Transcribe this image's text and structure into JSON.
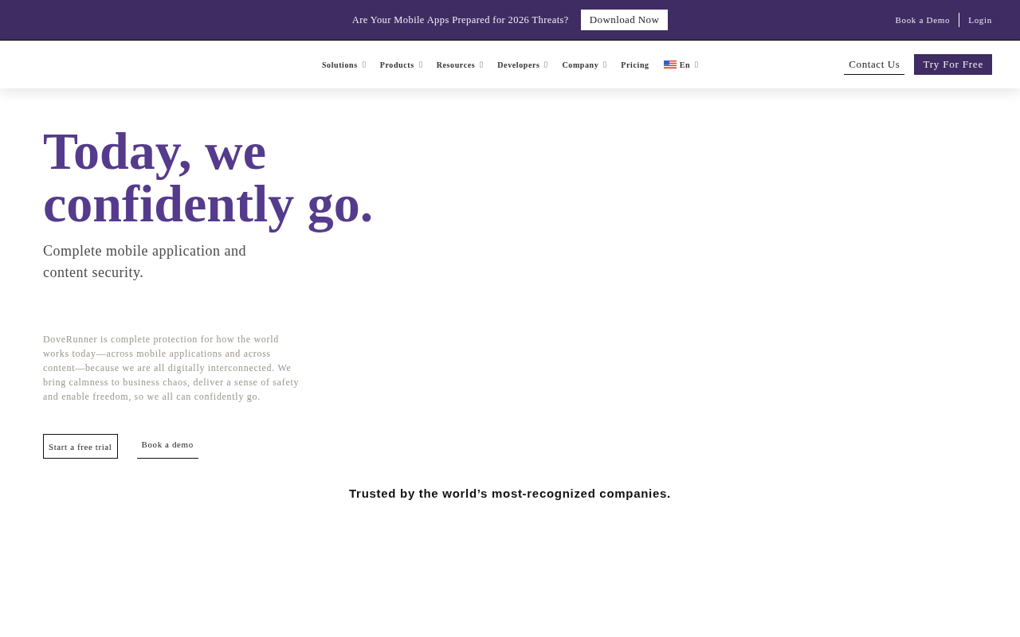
{
  "announcement_bar": {
    "message": "Are Your Mobile Apps Prepared for 2026 Threats?",
    "download_button": "Download Now",
    "links": [
      {
        "label": "Book a Demo"
      },
      {
        "label": "Login"
      }
    ]
  },
  "nav": {
    "items": [
      {
        "label": "Solutions",
        "kind": "link",
        "has_dropdown": true
      },
      {
        "label": "Products",
        "kind": "link",
        "has_dropdown": true
      },
      {
        "label": "Resources",
        "kind": "link",
        "has_dropdown": true
      },
      {
        "label": "Developers",
        "kind": "link",
        "has_dropdown": true
      },
      {
        "label": "Company",
        "kind": "link",
        "has_dropdown": true
      },
      {
        "label": "Pricing",
        "kind": "link",
        "has_dropdown": false
      },
      {
        "label": "En",
        "kind": "language",
        "has_dropdown": true
      }
    ],
    "contact_button": "Contact Us",
    "trial_button": "Try For Free"
  },
  "hero": {
    "title": "Today, we confidently go.",
    "subtitle": "Complete mobile application and content security.",
    "description": "DoveRunner is complete protection for how the world works today—across mobile applications and across content—because we are all digitally interconnected. We bring calmness to business chaos, deliver a sense of safety and enable freedom, so we all can confidently go.",
    "buttons": [
      {
        "label": "Start a free trial",
        "kind": "outlined"
      },
      {
        "label": "Book a demo",
        "kind": "underlined"
      }
    ]
  },
  "trusted": {
    "heading": "Trusted by the world’s most-recognized companies."
  }
}
